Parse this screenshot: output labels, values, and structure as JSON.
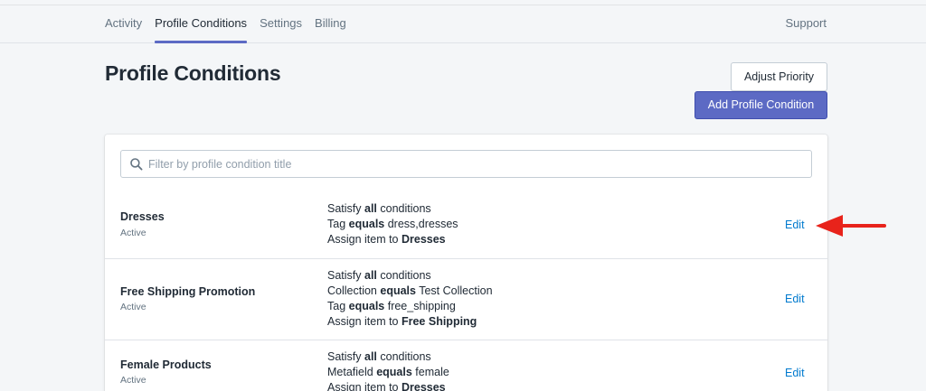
{
  "nav": {
    "tabs": [
      "Activity",
      "Profile Conditions",
      "Settings",
      "Billing"
    ],
    "active_tab": "Profile Conditions",
    "support": "Support"
  },
  "page": {
    "title": "Profile Conditions",
    "adjust_priority": "Adjust Priority",
    "add_condition": "Add Profile Condition"
  },
  "search": {
    "placeholder": "Filter by profile condition title",
    "value": ""
  },
  "rows": [
    {
      "name": "Dresses",
      "status": "Active",
      "conditions": [
        {
          "pre": "Satisfy ",
          "bold": "all",
          "post": " conditions"
        },
        {
          "pre": "Tag ",
          "bold": "equals",
          "post": " dress,dresses"
        },
        {
          "pre": "Assign item to ",
          "bold": "Dresses",
          "post": ""
        }
      ],
      "edit": "Edit"
    },
    {
      "name": "Free Shipping Promotion",
      "status": "Active",
      "conditions": [
        {
          "pre": "Satisfy ",
          "bold": "all",
          "post": " conditions"
        },
        {
          "pre": "Collection ",
          "bold": "equals",
          "post": " Test Collection"
        },
        {
          "pre": "Tag ",
          "bold": "equals",
          "post": " free_shipping"
        },
        {
          "pre": "Assign item to ",
          "bold": "Free Shipping",
          "post": ""
        }
      ],
      "edit": "Edit"
    },
    {
      "name": "Female Products",
      "status": "Active",
      "conditions": [
        {
          "pre": "Satisfy ",
          "bold": "all",
          "post": " conditions"
        },
        {
          "pre": "Metafield ",
          "bold": "equals",
          "post": " female"
        },
        {
          "pre": "Assign item to ",
          "bold": "Dresses",
          "post": ""
        }
      ],
      "edit": "Edit"
    }
  ],
  "colors": {
    "accent": "#5c6ac4",
    "link": "#007ace",
    "annotation_arrow": "#e8231b"
  }
}
